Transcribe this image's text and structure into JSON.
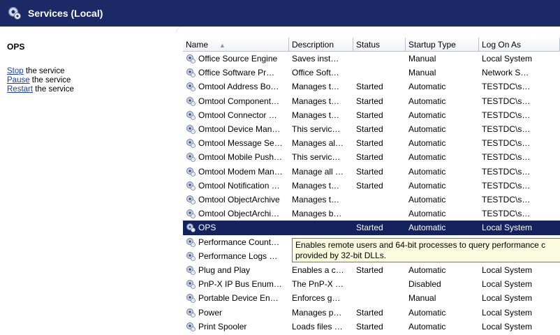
{
  "window": {
    "title": "Services (Local)"
  },
  "left_pane": {
    "service_name": "OPS",
    "actions": [
      {
        "link": "Stop",
        "text": " the service"
      },
      {
        "link": "Pause",
        "text": " the service"
      },
      {
        "link": "Restart",
        "text": " the service"
      }
    ]
  },
  "table": {
    "columns": [
      "Name",
      "Description",
      "Status",
      "Startup Type",
      "Log On As"
    ],
    "rows": [
      {
        "name": "Office  Source Engine",
        "description": "Saves inst…",
        "status": "",
        "startup": "Manual",
        "logon": "Local System"
      },
      {
        "name": "Office Software Pr…",
        "description": "Office Soft…",
        "status": "",
        "startup": "Manual",
        "logon": "Network S…"
      },
      {
        "name": "Omtool Address Bo…",
        "description": "Manages t…",
        "status": "Started",
        "startup": "Automatic",
        "logon": "TESTDC\\s…"
      },
      {
        "name": "Omtool Component…",
        "description": "Manages t…",
        "status": "Started",
        "startup": "Automatic",
        "logon": "TESTDC\\s…"
      },
      {
        "name": "Omtool Connector …",
        "description": "Manages t…",
        "status": "Started",
        "startup": "Automatic",
        "logon": "TESTDC\\s…"
      },
      {
        "name": "Omtool Device Man…",
        "description": "This servic…",
        "status": "Started",
        "startup": "Automatic",
        "logon": "TESTDC\\s…"
      },
      {
        "name": "Omtool Message Se…",
        "description": "Manages al…",
        "status": "Started",
        "startup": "Automatic",
        "logon": "TESTDC\\s…"
      },
      {
        "name": "Omtool Mobile Push…",
        "description": "This servic…",
        "status": "Started",
        "startup": "Automatic",
        "logon": "TESTDC\\s…"
      },
      {
        "name": "Omtool Modem Man…",
        "description": "Manage all …",
        "status": "Started",
        "startup": "Automatic",
        "logon": "TESTDC\\s…"
      },
      {
        "name": "Omtool Notification …",
        "description": "Manages t…",
        "status": "Started",
        "startup": "Automatic",
        "logon": "TESTDC\\s…"
      },
      {
        "name": "Omtool ObjectArchive",
        "description": "Manages t…",
        "status": "",
        "startup": "Automatic",
        "logon": "TESTDC\\s…"
      },
      {
        "name": "Omtool ObjectArchi…",
        "description": "Manages b…",
        "status": "",
        "startup": "Automatic",
        "logon": "TESTDC\\s…"
      },
      {
        "name": "OPS",
        "description": "",
        "status": "Started",
        "startup": "Automatic",
        "logon": "Local System",
        "selected": true
      },
      {
        "name": "Performance Count…",
        "description": "",
        "status": "",
        "startup": "",
        "logon": ""
      },
      {
        "name": "Performance Logs …",
        "description": "",
        "status": "",
        "startup": "",
        "logon": ""
      },
      {
        "name": "Plug and Play",
        "description": "Enables a c…",
        "status": "Started",
        "startup": "Automatic",
        "logon": "Local System"
      },
      {
        "name": "PnP-X IP Bus Enum…",
        "description": "The PnP-X …",
        "status": "",
        "startup": "Disabled",
        "logon": "Local System"
      },
      {
        "name": "Portable Device En…",
        "description": "Enforces g…",
        "status": "",
        "startup": "Manual",
        "logon": "Local System"
      },
      {
        "name": "Power",
        "description": "Manages p…",
        "status": "Started",
        "startup": "Automatic",
        "logon": "Local System"
      },
      {
        "name": "Print Spooler",
        "description": "Loads files …",
        "status": "Started",
        "startup": "Automatic",
        "logon": "Local System"
      }
    ]
  },
  "tooltip": {
    "line1": "Enables remote users and 64-bit processes to query performance c",
    "line2": "provided by 32-bit DLLs."
  },
  "colors": {
    "header_blue": "#1b2a66",
    "selection": "#14235e",
    "tooltip_bg": "#fbfbdf",
    "link": "#1f3fa0"
  },
  "icons": {
    "title": "services-gear-icon",
    "row": "service-gear-icon"
  }
}
